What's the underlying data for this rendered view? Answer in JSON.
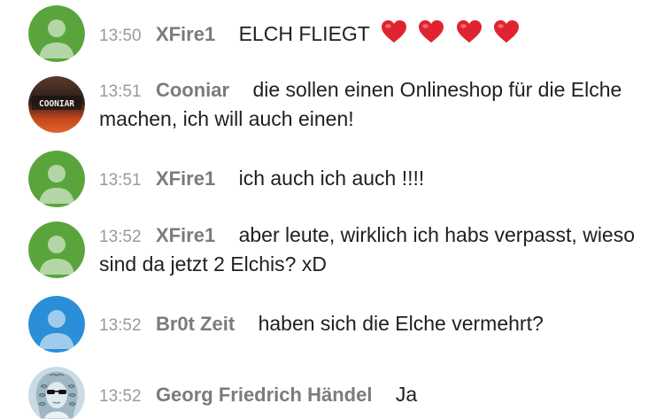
{
  "colors": {
    "avatar_green": "#5aa53b",
    "avatar_blue": "#2a8fd6",
    "timestamp": "#9a9a9a",
    "username": "#7b7b7b",
    "text": "#1f1f1f",
    "heart": "#e0242f"
  },
  "messages": [
    {
      "time": "13:50",
      "user": "XFire1",
      "text": "ELCH FLIEGT",
      "emoji": [
        "heart-emoji",
        "heart-emoji",
        "heart-emoji",
        "heart-emoji"
      ],
      "avatar": "default-user-avatar-green"
    },
    {
      "time": "13:51",
      "user": "Cooniar",
      "text": "die sollen einen Onlineshop für die Elche machen, ich will auch einen!",
      "avatar": "cooniar-logo-avatar",
      "avatar_text": "COONIAR"
    },
    {
      "time": "13:51",
      "user": "XFire1",
      "text": "ich auch ich auch !!!!",
      "avatar": "default-user-avatar-green"
    },
    {
      "time": "13:52",
      "user": "XFire1",
      "text": "aber leute, wirklich ich habs verpasst, wieso sind da jetzt 2 Elchis? xD",
      "avatar": "default-user-avatar-green"
    },
    {
      "time": "13:52",
      "user": "Br0t Zeit",
      "text": "haben sich die Elche vermehrt?",
      "avatar": "default-user-avatar-blue"
    },
    {
      "time": "13:52",
      "user": "Georg Friedrich Händel",
      "text": "Ja",
      "avatar": "handel-portrait-avatar"
    }
  ]
}
